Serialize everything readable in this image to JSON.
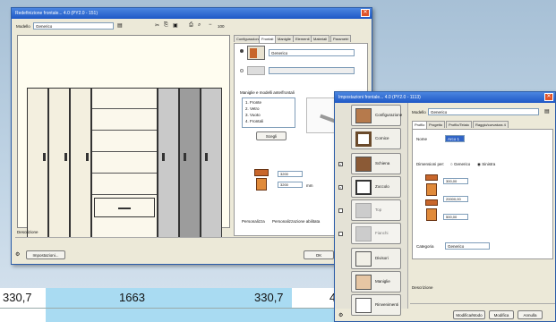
{
  "table": {
    "values": [
      "330,7",
      "1663",
      "330,7",
      "4"
    ]
  },
  "main_window": {
    "title": "Redefinizione frontale... 4.0 (PY2.0 - 151)",
    "model_label": "Modello",
    "model_value": "Generico",
    "zoom_label": "100",
    "tabs": [
      "Configurazione",
      "Frontali",
      "Maniglie",
      "Elementi",
      "Materiali",
      "Parametri"
    ],
    "active_tab": 1,
    "front_select": "Generico",
    "list_title": "Maniglie e modelli ante/frontali",
    "list_items": [
      "1. Fronte",
      "2. Vetro",
      "3. Vuoto",
      "4. Frontali"
    ],
    "apply_button": "Scegli",
    "dim_values": [
      "3200",
      "3200"
    ],
    "dim_unit": "mm",
    "bottom_labels": [
      "Personalizza",
      "Personalizzazione abilitata"
    ],
    "status": "Descrizione",
    "left_button": "Impostazioni...",
    "ok_button": "OK"
  },
  "second_window": {
    "title": "Impostazioni frontale... 4.0 (PY2.0 - 1113)",
    "model_label": "Modello",
    "model_value": "Generico",
    "nav_items": [
      "Configurazione",
      "Cornice",
      "Schiena",
      "Zoccolo",
      "Top",
      "Fianchi",
      "Divisori",
      "Maniglie",
      "Rinvenimenti"
    ],
    "tabs": [
      "Profilo",
      "Progetto",
      "Profilo/Telaio",
      "Raggio/curvatura 4"
    ],
    "name_label": "Nome",
    "name_value": "Arco 1",
    "dimension_label": "Dimensioni per:",
    "radio_options": [
      "Generico",
      "Sinistra"
    ],
    "dims": [
      "300,00",
      "20000,00",
      "500,00"
    ],
    "category_label": "Categoria",
    "category_value": "Generico",
    "status": "Descrizione",
    "buttons": [
      "Modifica/Modo",
      "Modifica",
      "Annulla"
    ]
  }
}
